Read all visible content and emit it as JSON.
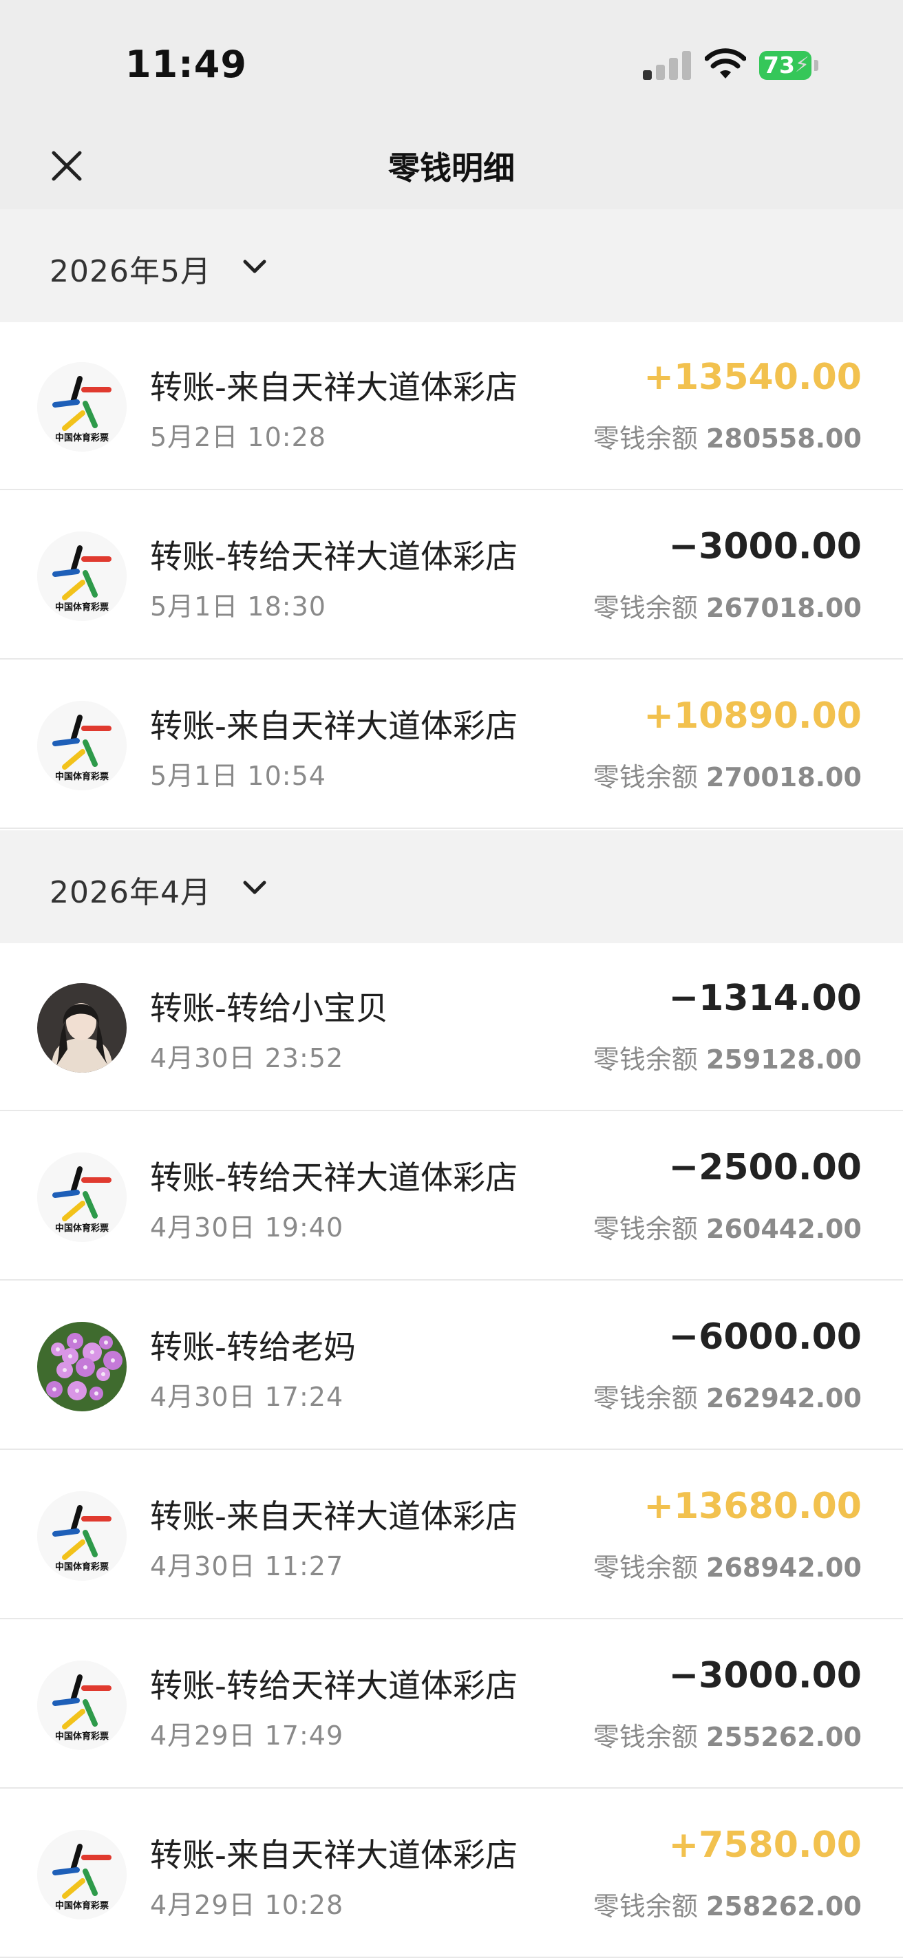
{
  "status_bar": {
    "time": "11:49",
    "battery": "73"
  },
  "nav": {
    "title": "零钱明细",
    "close_icon": "close-icon"
  },
  "balance_label": "零钱余额",
  "months": [
    {
      "label": "2026年5月",
      "transactions": [
        {
          "title": "转账-来自天祥大道体彩店",
          "time": "5月2日 10:28",
          "amount": "+13540.00",
          "direction": "in",
          "balance": "280558.00",
          "avatar": "lottery-logo-icon",
          "logo_caption": "中国体育彩票"
        },
        {
          "title": "转账-转给天祥大道体彩店",
          "time": "5月1日 18:30",
          "amount": "−3000.00",
          "direction": "out",
          "balance": "267018.00",
          "avatar": "lottery-logo-icon",
          "logo_caption": "中国体育彩票"
        },
        {
          "title": "转账-来自天祥大道体彩店",
          "time": "5月1日 10:54",
          "amount": "+10890.00",
          "direction": "in",
          "balance": "270018.00",
          "avatar": "lottery-logo-icon",
          "logo_caption": "中国体育彩票"
        }
      ]
    },
    {
      "label": "2026年4月",
      "transactions": [
        {
          "title": "转账-转给小宝贝",
          "time": "4月30日 23:52",
          "amount": "−1314.00",
          "direction": "out",
          "balance": "259128.00",
          "avatar": "person-photo-icon"
        },
        {
          "title": "转账-转给天祥大道体彩店",
          "time": "4月30日 19:40",
          "amount": "−2500.00",
          "direction": "out",
          "balance": "260442.00",
          "avatar": "lottery-logo-icon",
          "logo_caption": "中国体育彩票"
        },
        {
          "title": "转账-转给老妈",
          "time": "4月30日 17:24",
          "amount": "−6000.00",
          "direction": "out",
          "balance": "262942.00",
          "avatar": "flowers-photo-icon"
        },
        {
          "title": "转账-来自天祥大道体彩店",
          "time": "4月30日 11:27",
          "amount": "+13680.00",
          "direction": "in",
          "balance": "268942.00",
          "avatar": "lottery-logo-icon",
          "logo_caption": "中国体育彩票"
        },
        {
          "title": "转账-转给天祥大道体彩店",
          "time": "4月29日 17:49",
          "amount": "−3000.00",
          "direction": "out",
          "balance": "255262.00",
          "avatar": "lottery-logo-icon",
          "logo_caption": "中国体育彩票"
        },
        {
          "title": "转账-来自天祥大道体彩店",
          "time": "4月29日 10:28",
          "amount": "+7580.00",
          "direction": "in",
          "balance": "258262.00",
          "avatar": "lottery-logo-icon",
          "logo_caption": "中国体育彩票"
        }
      ]
    }
  ],
  "colors": {
    "income": "#f2c14e",
    "expense": "#222222",
    "header_bg": "#ededed",
    "section_bg": "#f2f2f2"
  }
}
